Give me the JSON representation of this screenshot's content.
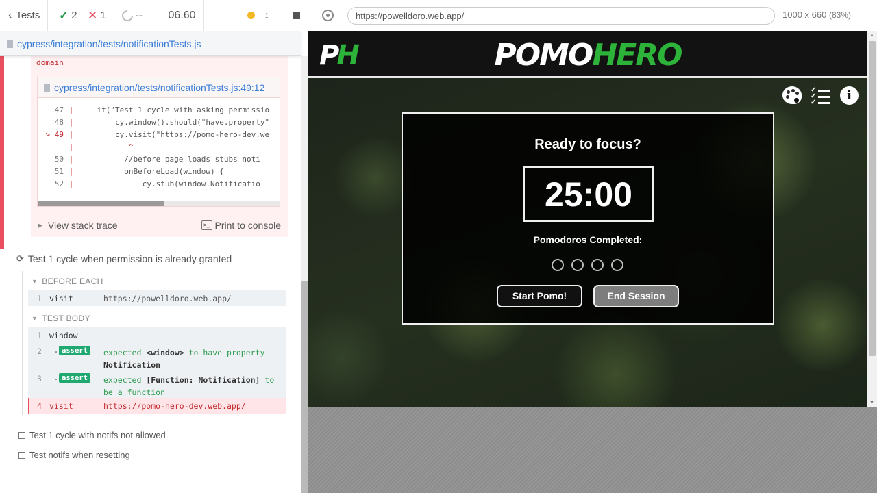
{
  "reporter": {
    "back_label": "Tests",
    "passed": "2",
    "failed": "1",
    "pending": "--",
    "duration": "06.60",
    "spec_path": "cypress/integration/tests/notificationTests.js",
    "error": {
      "tail_text": "domain",
      "code_file": "cypress/integration/tests/notificationTests.js:49:12",
      "code_lines": [
        {
          "num": "47",
          "text": "    it(\"Test 1 cycle with asking permissio"
        },
        {
          "num": "48",
          "text": "        cy.window().should(\"have.property\""
        },
        {
          "num": "> 49",
          "text": "        cy.visit(\"https://pomo-hero-dev.we"
        },
        {
          "num": "",
          "text": "           ^"
        },
        {
          "num": "50",
          "text": "          //before page loads stubs noti"
        },
        {
          "num": "51",
          "text": "          onBeforeLoad(window) {"
        },
        {
          "num": "52",
          "text": "              cy.stub(window.Notificatio"
        }
      ],
      "view_stack_trace": "View stack trace",
      "print_to_console": "Print to console"
    },
    "test2": {
      "title": "Test 1 cycle when permission is already granted",
      "before_each": "BEFORE EACH",
      "test_body": "TEST BODY",
      "before_cmd": {
        "num": "1",
        "name": "visit",
        "msg": "https://powelldoro.web.app/"
      },
      "body_cmds": [
        {
          "num": "1",
          "name": "window"
        },
        {
          "num": "2",
          "name": "-",
          "badge": "assert",
          "msg_pre": "expected ",
          "msg_b1": "<window>",
          "msg_mid": " to have property ",
          "msg_b2": "Notification"
        },
        {
          "num": "3",
          "name": "-",
          "badge": "assert",
          "msg_pre": "expected ",
          "msg_b1": "[Function: Notification]",
          "msg_mid": " to be a function",
          "msg_b2": ""
        },
        {
          "num": "4",
          "name": "visit",
          "msg": "https://pomo-hero-dev.web.app/"
        }
      ]
    },
    "pending_tests": [
      "Test 1 cycle with notifs not allowed",
      "Test notifs when resetting"
    ]
  },
  "aut": {
    "url": "https://powelldoro.web.app/",
    "viewport": "1000 x 660",
    "zoom": "(83%)"
  },
  "app": {
    "logo_p": "P",
    "logo_h": "H",
    "brand_pomo": "POMO",
    "brand_hero": "HERO",
    "ready_text": "Ready to focus?",
    "timer": "25:00",
    "completed_label": "Pomodoros Completed:",
    "pomodoros_completed": 0,
    "pomodoro_total": 4,
    "start_btn": "Start Pomo!",
    "end_btn": "End Session",
    "info_glyph": "i"
  },
  "colors": {
    "pass": "#2c9b4f",
    "fail": "#e94f5f",
    "brand_green": "#2db33a",
    "link": "#3b7ed8"
  },
  "icons": [
    "chevron-left-icon",
    "check-icon",
    "x-icon",
    "spinner-icon",
    "file-icon",
    "terminal-icon",
    "target-icon",
    "palette-icon",
    "checklist-icon",
    "info-icon",
    "stop-icon"
  ]
}
